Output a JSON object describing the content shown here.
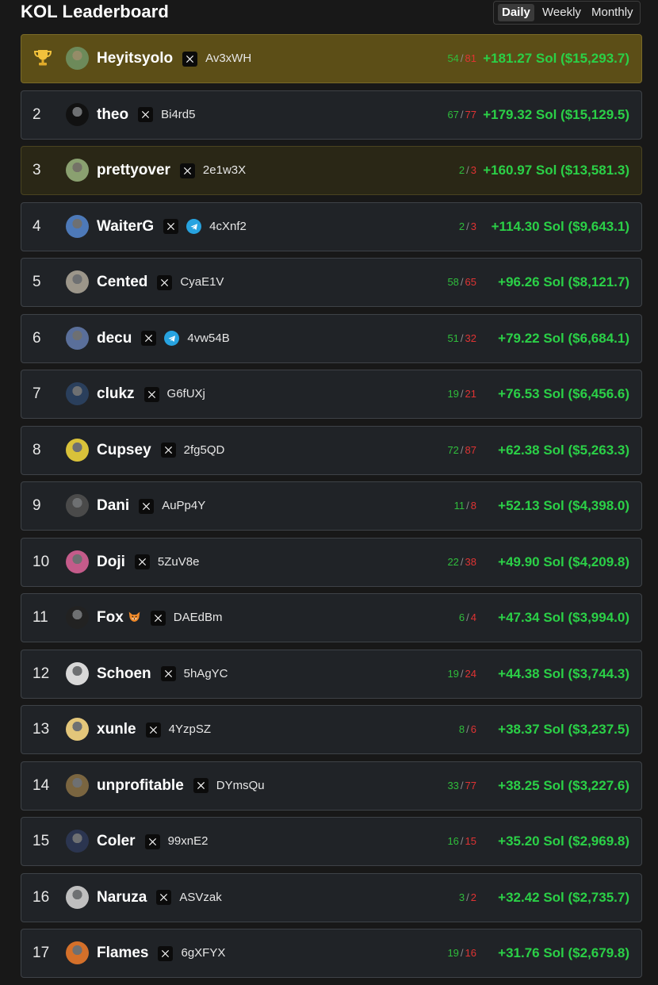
{
  "header": {
    "title": "KOL Leaderboard",
    "tabs": [
      "Daily",
      "Weekly",
      "Monthly"
    ],
    "active_tab": "Daily"
  },
  "colors": {
    "win": "#2fbd3c",
    "loss": "#e03333",
    "pnl": "#2bd047",
    "top_row": "#5c4e17",
    "telegram": "#27a3e0"
  },
  "rows": [
    {
      "rank": "",
      "icon": "trophy-icon",
      "name": "Heyitsyolo",
      "socials": [
        "x"
      ],
      "address": "Av3xWH",
      "wins": "54",
      "losses": "81",
      "pnl": "+181.27 Sol ($15,293.7)",
      "avatar": "#6d8a5a"
    },
    {
      "rank": "2",
      "name": "theo",
      "socials": [
        "x"
      ],
      "address": "Bi4rd5",
      "wins": "67",
      "losses": "77",
      "pnl": "+179.32 Sol ($15,129.5)",
      "avatar": "#111111"
    },
    {
      "rank": "3",
      "name": "prettyover",
      "socials": [
        "x"
      ],
      "address": "2e1w3X",
      "wins": "2",
      "losses": "3",
      "pnl": "+160.97 Sol ($13,581.3)",
      "avatar": "#8aa070"
    },
    {
      "rank": "4",
      "name": "WaiterG",
      "socials": [
        "x",
        "telegram"
      ],
      "address": "4cXnf2",
      "wins": "2",
      "losses": "3",
      "pnl": "+114.30 Sol ($9,643.1)",
      "avatar": "#4d79b8"
    },
    {
      "rank": "5",
      "name": "Cented",
      "socials": [
        "x"
      ],
      "address": "CyaE1V",
      "wins": "58",
      "losses": "65",
      "pnl": "+96.26 Sol ($8,121.7)",
      "avatar": "#9c968a"
    },
    {
      "rank": "6",
      "name": "decu",
      "socials": [
        "x",
        "telegram"
      ],
      "address": "4vw54B",
      "wins": "51",
      "losses": "32",
      "pnl": "+79.22 Sol ($6,684.1)",
      "avatar": "#5a6f9a"
    },
    {
      "rank": "7",
      "name": "clukz",
      "socials": [
        "x"
      ],
      "address": "G6fUXj",
      "wins": "19",
      "losses": "21",
      "pnl": "+76.53 Sol ($6,456.6)",
      "avatar": "#2a3f5c"
    },
    {
      "rank": "8",
      "name": "Cupsey",
      "socials": [
        "x"
      ],
      "address": "2fg5QD",
      "wins": "72",
      "losses": "87",
      "pnl": "+62.38 Sol ($5,263.3)",
      "avatar": "#d9c23a"
    },
    {
      "rank": "9",
      "name": "Dani",
      "socials": [
        "x"
      ],
      "address": "AuPp4Y",
      "wins": "11",
      "losses": "8",
      "pnl": "+52.13 Sol ($4,398.0)",
      "avatar": "#4a4a4a"
    },
    {
      "rank": "10",
      "name": "Doji",
      "socials": [
        "x"
      ],
      "address": "5ZuV8e",
      "wins": "22",
      "losses": "38",
      "pnl": "+49.90 Sol ($4,209.8)",
      "avatar": "#c45b8a"
    },
    {
      "rank": "11",
      "name": "Fox",
      "emoji": true,
      "socials": [
        "x"
      ],
      "address": "DAEdBm",
      "wins": "6",
      "losses": "4",
      "pnl": "+47.34 Sol ($3,994.0)",
      "avatar": "#222222"
    },
    {
      "rank": "12",
      "name": "Schoen",
      "socials": [
        "x"
      ],
      "address": "5hAgYC",
      "wins": "19",
      "losses": "24",
      "pnl": "+44.38 Sol ($3,744.3)",
      "avatar": "#d8d8d8"
    },
    {
      "rank": "13",
      "name": "xunle",
      "socials": [
        "x"
      ],
      "address": "4YzpSZ",
      "wins": "8",
      "losses": "6",
      "pnl": "+38.37 Sol ($3,237.5)",
      "avatar": "#e3c67a"
    },
    {
      "rank": "14",
      "name": "unprofitable",
      "socials": [
        "x"
      ],
      "address": "DYmsQu",
      "wins": "33",
      "losses": "77",
      "pnl": "+38.25 Sol ($3,227.6)",
      "avatar": "#7a6540"
    },
    {
      "rank": "15",
      "name": "Coler",
      "socials": [
        "x"
      ],
      "address": "99xnE2",
      "wins": "16",
      "losses": "15",
      "pnl": "+35.20 Sol ($2,969.8)",
      "avatar": "#2b3550"
    },
    {
      "rank": "16",
      "name": "Naruza",
      "socials": [
        "x"
      ],
      "address": "ASVzak",
      "wins": "3",
      "losses": "2",
      "pnl": "+32.42 Sol ($2,735.7)",
      "avatar": "#bfbfbf"
    },
    {
      "rank": "17",
      "name": "Flames",
      "socials": [
        "x"
      ],
      "address": "6gXFYX",
      "wins": "19",
      "losses": "16",
      "pnl": "+31.76 Sol ($2,679.8)",
      "avatar": "#d4702a"
    }
  ]
}
